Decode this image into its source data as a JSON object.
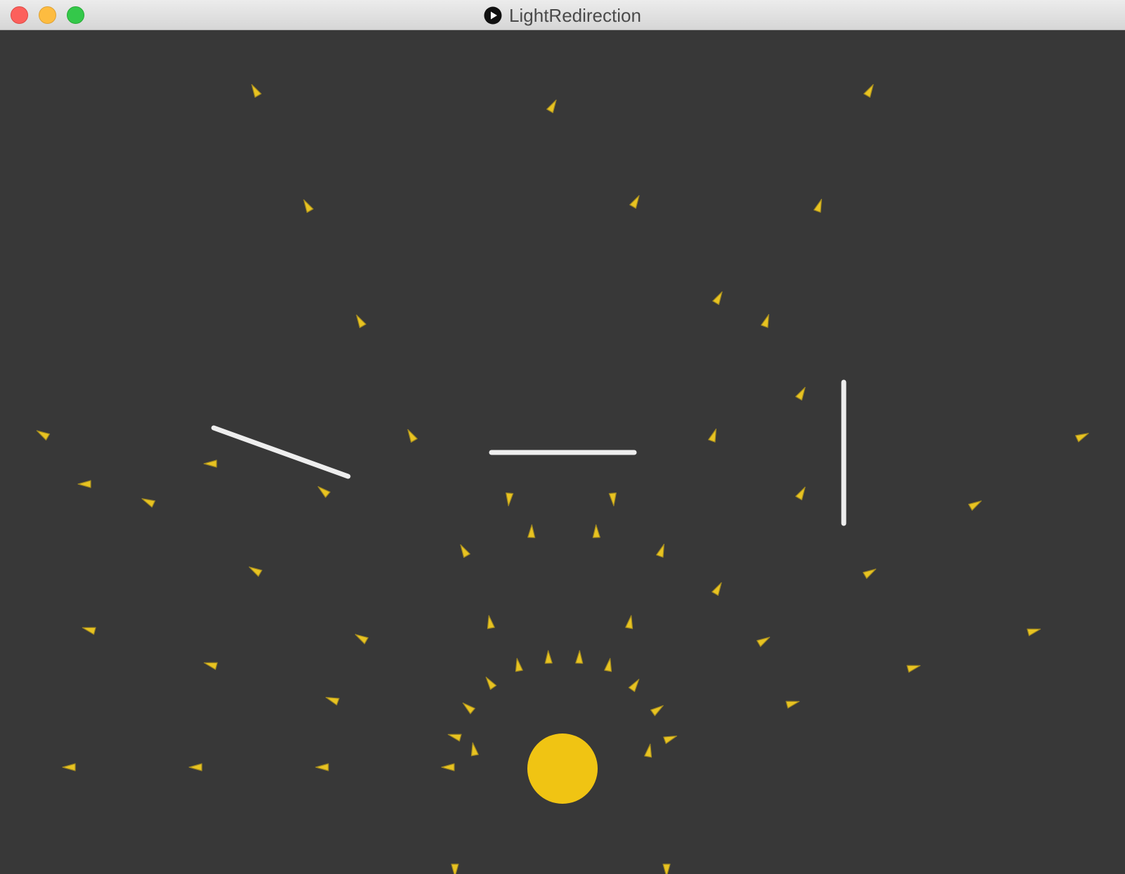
{
  "window": {
    "title": "LightRedirection",
    "app_icon": "play-circle-icon",
    "controls": [
      "close-button",
      "minimize-button",
      "maximize-button"
    ]
  },
  "scene": {
    "background_color": "#383838",
    "light_source": {
      "name": "light-source",
      "color": "#f0c413"
    },
    "mirrors": {
      "color": "#eeeeee",
      "items": [
        "mirror-left",
        "mirror-center",
        "mirror-right"
      ]
    },
    "particles": {
      "color": "#e8c321",
      "outline": "#a08820"
    }
  }
}
